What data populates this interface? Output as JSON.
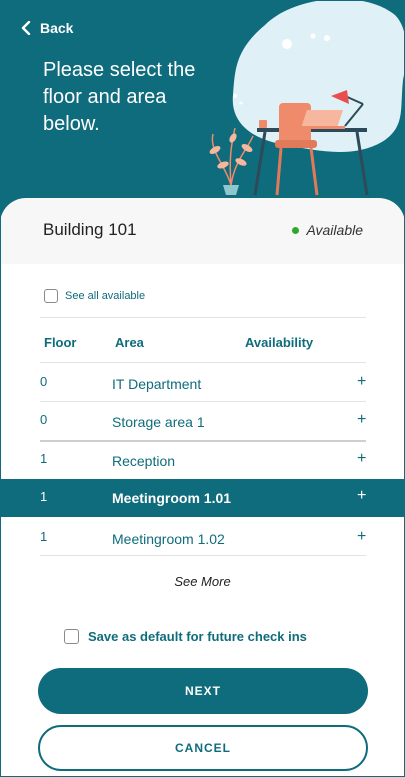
{
  "header": {
    "back_label": "Back",
    "title": "Please select the floor and area below."
  },
  "building": {
    "name": "Building 101",
    "status": "Available",
    "status_color": "#2fa82f"
  },
  "filters": {
    "see_all_label": "See all available",
    "see_all_checked": false
  },
  "table": {
    "headers": {
      "floor": "Floor",
      "area": "Area",
      "availability": "Availability"
    },
    "rows": [
      {
        "floor": "0",
        "area": "IT Department",
        "action": "+"
      },
      {
        "floor": "0",
        "area": "Storage area 1",
        "action": "+"
      },
      {
        "floor": "1",
        "area": "Reception",
        "action": "+"
      },
      {
        "floor": "1",
        "area": "Meetingroom 1.01",
        "action": "+",
        "selected": true
      },
      {
        "floor": "1",
        "area": "Meetingroom 1.02",
        "action": "+"
      }
    ],
    "see_more_label": "See More"
  },
  "save_default": {
    "label": "Save as default for future check ins",
    "checked": false
  },
  "actions": {
    "next_label": "NEXT",
    "cancel_label": "CANCEL"
  },
  "colors": {
    "accent": "#0f6c7c",
    "blob": "#dff1f6"
  }
}
